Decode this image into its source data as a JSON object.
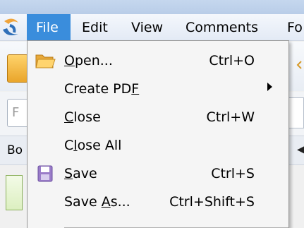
{
  "menubar": {
    "items": [
      {
        "label": "File",
        "active": true
      },
      {
        "label": "Edit"
      },
      {
        "label": "View"
      },
      {
        "label": "Comments"
      },
      {
        "label": "Fo"
      }
    ]
  },
  "background": {
    "field_placeholder": "F",
    "panel_label": "Bo"
  },
  "file_menu": {
    "open": {
      "pre": "",
      "u": "O",
      "post": "pen...",
      "shortcut": "Ctrl+O",
      "icon": "folder-icon"
    },
    "create_pdf": {
      "pre": "Create PD",
      "u": "F",
      "post": "",
      "shortcut": ""
    },
    "close": {
      "pre": "",
      "u": "C",
      "post": "lose",
      "shortcut": "Ctrl+W"
    },
    "close_all": {
      "pre": "C",
      "u": "l",
      "post": "ose All",
      "shortcut": ""
    },
    "save": {
      "pre": "",
      "u": "S",
      "post": "ave",
      "shortcut": "Ctrl+S",
      "icon": "save-icon"
    },
    "save_as": {
      "pre": "Save ",
      "u": "A",
      "post": "s...",
      "shortcut": "Ctrl+Shift+S"
    }
  },
  "colors": {
    "menu_active": "#3a8ddc",
    "menu_bg": "#f5f5f5"
  }
}
